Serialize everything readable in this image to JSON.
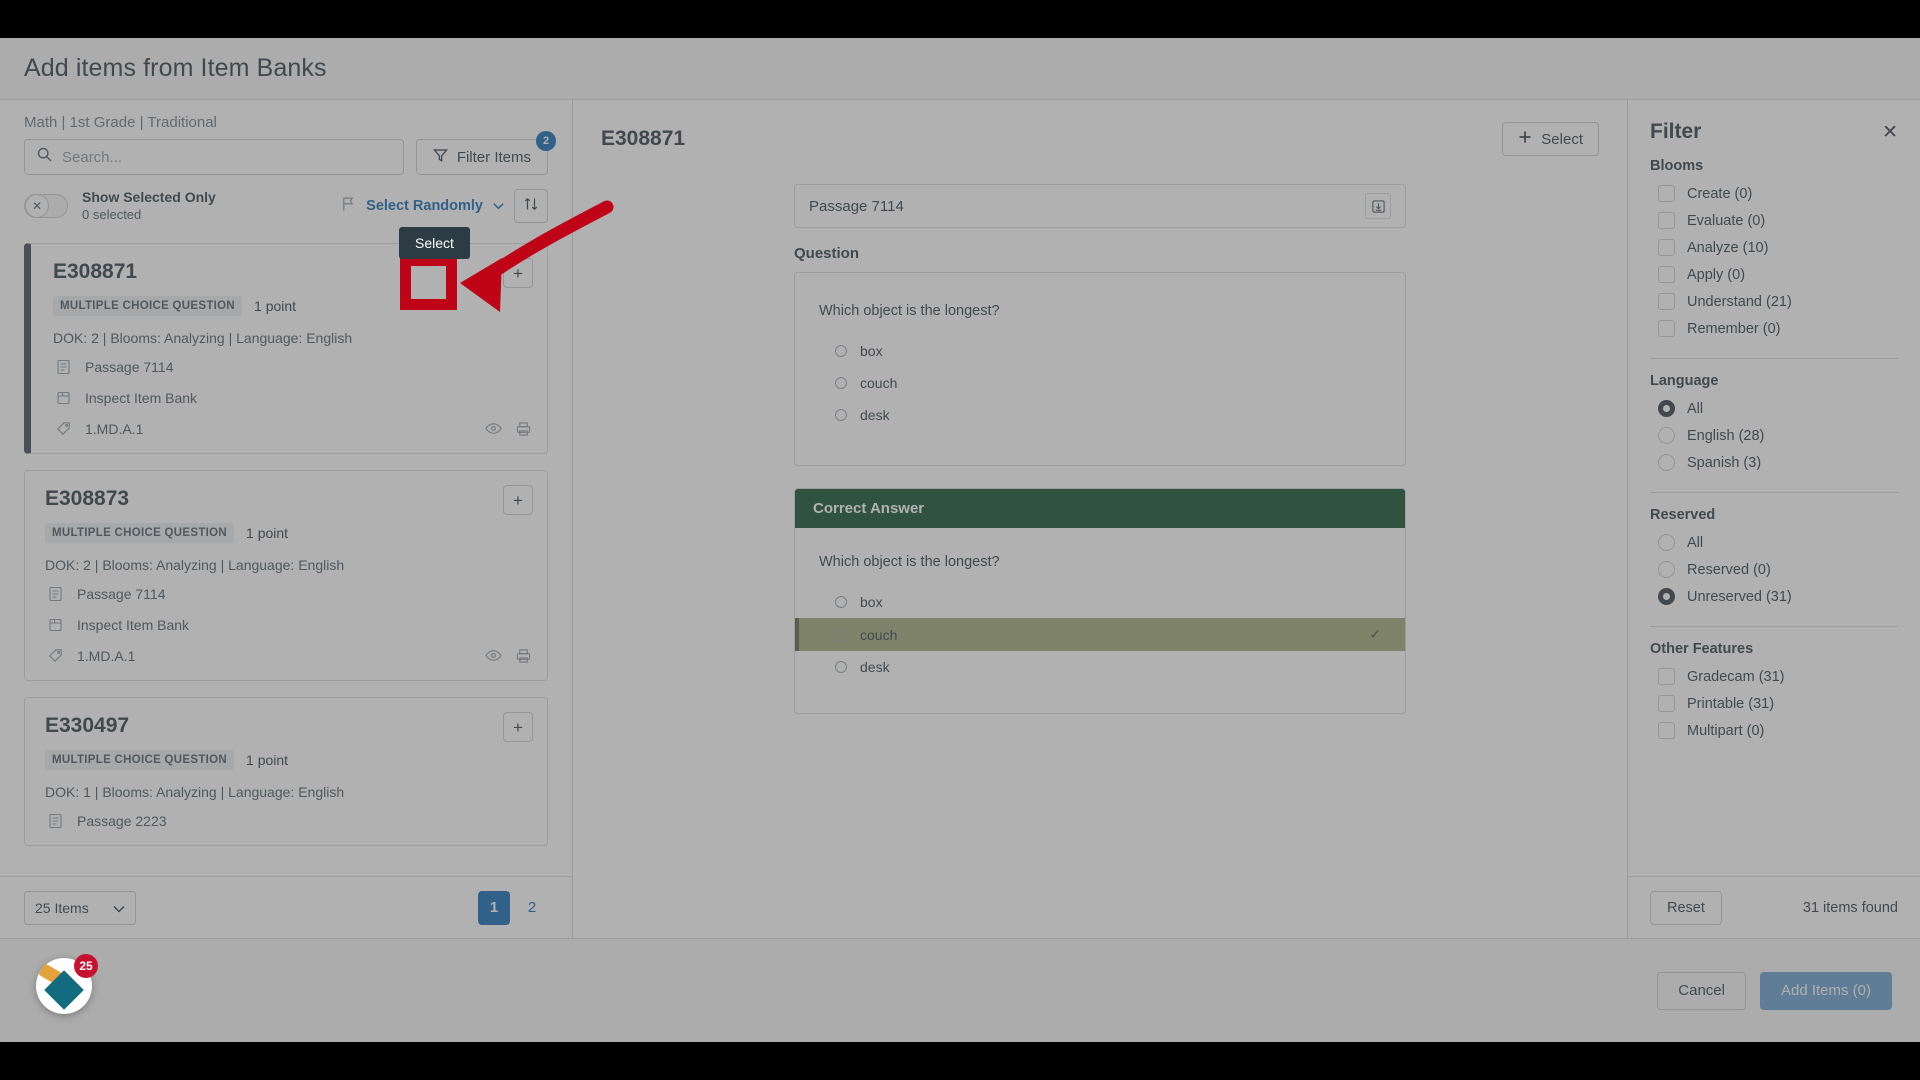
{
  "header": {
    "title": "Add items from Item Banks"
  },
  "left": {
    "breadcrumb": "Math | 1st Grade | Traditional",
    "search": {
      "placeholder": "Search...",
      "value": ""
    },
    "filter_items": {
      "label": "Filter Items",
      "badge": "2"
    },
    "show_selected": {
      "label": "Show Selected Only",
      "sub": "0 selected",
      "toggle_glyph": "✕"
    },
    "select_randomly": {
      "label": "Select Randomly"
    },
    "cards": [
      {
        "id": "E308871",
        "type_pill": "MULTIPLE CHOICE QUESTION",
        "points": "1 point",
        "meta": "DOK: 2  |  Blooms: Analyzing  |  Language: English",
        "passage": "Passage 7114",
        "inspect": "Inspect Item Bank",
        "standard": "1.MD.A.1",
        "plus": "+",
        "active": true
      },
      {
        "id": "E308873",
        "type_pill": "MULTIPLE CHOICE QUESTION",
        "points": "1 point",
        "meta": "DOK: 2  |  Blooms: Analyzing  |  Language: English",
        "passage": "Passage 7114",
        "inspect": "Inspect Item Bank",
        "standard": "1.MD.A.1",
        "plus": "+",
        "active": false
      },
      {
        "id": "E330497",
        "type_pill": "MULTIPLE CHOICE QUESTION",
        "points": "1 point",
        "meta": "DOK: 1  |  Blooms: Analyzing  |  Language: English",
        "passage": "Passage 2223",
        "inspect": "",
        "standard": "",
        "plus": "+",
        "active": false
      }
    ],
    "footer": {
      "per_page": "25 Items",
      "pages": [
        "1",
        "2"
      ],
      "current_page": "1"
    }
  },
  "center": {
    "title": "E308871",
    "select_button": "Select",
    "passage": "Passage 7114",
    "question_label": "Question",
    "question_text": "Which object is the longest?",
    "options": [
      "box",
      "couch",
      "desk"
    ],
    "correct_answer_label": "Correct Answer",
    "correct_question_text": "Which object is the longest?",
    "correct_options": [
      "box",
      "couch",
      "desk"
    ],
    "correct_value": "couch",
    "check_glyph": "✓"
  },
  "filter": {
    "title": "Filter",
    "close_glyph": "✕",
    "groups": [
      {
        "title": "Blooms",
        "control": "checkbox",
        "options": [
          {
            "label": "Create (0)",
            "checked": false
          },
          {
            "label": "Evaluate (0)",
            "checked": false
          },
          {
            "label": "Analyze (10)",
            "checked": false
          },
          {
            "label": "Apply (0)",
            "checked": false
          },
          {
            "label": "Understand (21)",
            "checked": false
          },
          {
            "label": "Remember (0)",
            "checked": false
          }
        ]
      },
      {
        "title": "Language",
        "control": "radio",
        "options": [
          {
            "label": "All",
            "checked": true
          },
          {
            "label": "English (28)",
            "checked": false
          },
          {
            "label": "Spanish (3)",
            "checked": false
          }
        ]
      },
      {
        "title": "Reserved",
        "control": "radio",
        "options": [
          {
            "label": "All",
            "checked": false
          },
          {
            "label": "Reserved (0)",
            "checked": false
          },
          {
            "label": "Unreserved (31)",
            "checked": true
          }
        ]
      },
      {
        "title": "Other Features",
        "control": "checkbox",
        "options": [
          {
            "label": "Gradecam (31)",
            "checked": false
          },
          {
            "label": "Printable (31)",
            "checked": false
          },
          {
            "label": "Multipart (0)",
            "checked": false
          }
        ]
      }
    ],
    "reset": "Reset",
    "items_found": "31 items found"
  },
  "footer": {
    "cancel": "Cancel",
    "add_items": "Add Items (0)"
  },
  "annotations": {
    "tooltip": "Select",
    "highlight_color": "#c00418"
  },
  "chat": {
    "badge": "25"
  }
}
